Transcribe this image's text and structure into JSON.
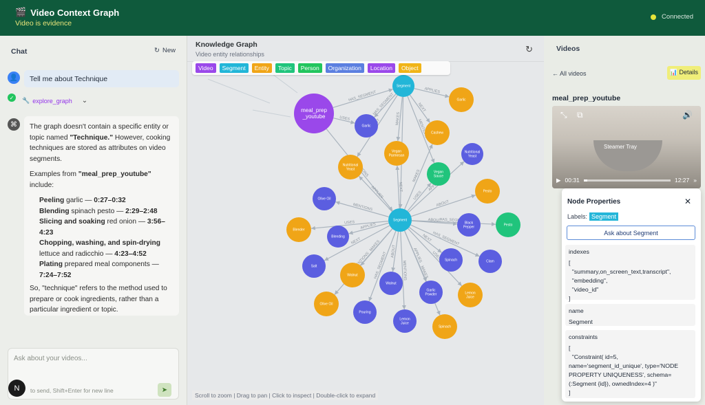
{
  "header": {
    "icon": "clapper-icon",
    "title": "Video Context Graph",
    "subtitle": "Video is evidence",
    "status": "Connected"
  },
  "chat": {
    "title": "Chat",
    "new_label": "New",
    "user_message": "Tell me about Technique",
    "tool_call": "explore_graph",
    "assistant": {
      "intro_1": "The graph doesn't contain a specific entity or topic named ",
      "intro_bold": "\"Technique.\"",
      "intro_2": " However, cooking techniques are stored as attributes on video segments.",
      "examples_1": "Examples from ",
      "examples_bold": "\"meal_prep_youtube\"",
      "examples_2": " include:",
      "items": [
        {
          "term": "Peeling",
          "rest": " garlic — ",
          "time": "0:27–0:32"
        },
        {
          "term": "Blending",
          "rest": " spinach pesto — ",
          "time": "2:29–2:48"
        },
        {
          "term": "Slicing and soaking",
          "rest": " red onion — ",
          "time": "3:56–4:23"
        },
        {
          "term": "Chopping, washing, and spin-drying",
          "rest": " lettuce and radicchio — ",
          "time": "4:23–4:52"
        },
        {
          "term": "Plating",
          "rest": " prepared meal components — ",
          "time": "7:24–7:52"
        }
      ],
      "conclusion": "So, \"technique\" refers to the method used to prepare or cook ingredients, rather than a particular ingredient or topic."
    },
    "input_placeholder": "Ask about your videos...",
    "input_hint": "to send, Shift+Enter for new line",
    "avatar_initial": "N"
  },
  "graph": {
    "title": "Knowledge Graph",
    "subtitle": "Video entity relationships",
    "legend": [
      {
        "label": "Video",
        "color": "#9a48ea"
      },
      {
        "label": "Segment",
        "color": "#22b6d8"
      },
      {
        "label": "Entity",
        "color": "#f0a517"
      },
      {
        "label": "Topic",
        "color": "#20c47c"
      },
      {
        "label": "Person",
        "color": "#22c55e"
      },
      {
        "label": "Organization",
        "color": "#5b7fe0"
      },
      {
        "label": "Location",
        "color": "#9a48ea"
      },
      {
        "label": "Object",
        "color": "#f0b417"
      }
    ],
    "help": "Scroll to zoom | Drag to pan | Click to inspect | Double-click to expand",
    "edge_labels": [
      "HAS_SEGMENT",
      "MENTIONS",
      "USES",
      "APPLIES",
      "NEXT",
      "MAKES",
      "ABOUT"
    ],
    "nodes": [
      {
        "id": "video",
        "label": "meal_prep\n_youtube",
        "color": "#9a48ea"
      },
      {
        "id": "seg1",
        "label": "Segment",
        "color": "#22b6d8"
      },
      {
        "id": "seg2",
        "label": "Segment",
        "color": "#22b6d8"
      },
      {
        "id": "garlic1",
        "label": "Garlic",
        "color": "#f0a517"
      },
      {
        "id": "garlic2",
        "label": "Garlic",
        "color": "#5b5ee0"
      },
      {
        "id": "cashew",
        "label": "Cashew",
        "color": "#f0a517"
      },
      {
        "id": "vegan_parm",
        "label": "Vegan\nParmesan",
        "color": "#f0a517"
      },
      {
        "id": "nutr1",
        "label": "Nutritional\nYeast",
        "color": "#f0a517"
      },
      {
        "id": "nutr2",
        "label": "Nutritional\nYeast",
        "color": "#5b5ee0"
      },
      {
        "id": "vegan_sauce",
        "label": "Vegan\nSauce",
        "color": "#20c47c"
      },
      {
        "id": "pesto1",
        "label": "Pesto",
        "color": "#f0a517"
      },
      {
        "id": "pesto2",
        "label": "Pesto",
        "color": "#20c47c"
      },
      {
        "id": "olive1",
        "label": "Olive Oil",
        "color": "#5b5ee0"
      },
      {
        "id": "olive2",
        "label": "Olive Oil",
        "color": "#f0a517"
      },
      {
        "id": "blender",
        "label": "Blender",
        "color": "#f0a517"
      },
      {
        "id": "blending",
        "label": "Blending",
        "color": "#5b5ee0"
      },
      {
        "id": "salt",
        "label": "Salt",
        "color": "#5b5ee0"
      },
      {
        "id": "walnut1",
        "label": "Walnut",
        "color": "#f0a517"
      },
      {
        "id": "walnut2",
        "label": "Walnut",
        "color": "#5b5ee0"
      },
      {
        "id": "pouring",
        "label": "Pouring",
        "color": "#5b5ee0"
      },
      {
        "id": "lemon1",
        "label": "Lemon\nJuice",
        "color": "#5b5ee0"
      },
      {
        "id": "lemon2",
        "label": "Lemon\nJuice",
        "color": "#f0a517"
      },
      {
        "id": "garlic_pw",
        "label": "Garlic\nPowder",
        "color": "#5b5ee0"
      },
      {
        "id": "spinach1",
        "label": "Spinach",
        "color": "#5b5ee0"
      },
      {
        "id": "spinach2",
        "label": "Spinach",
        "color": "#f0a517"
      },
      {
        "id": "blackpep",
        "label": "Black\nPepper",
        "color": "#5b5ee0"
      },
      {
        "id": "clam",
        "label": "Clam",
        "color": "#5b5ee0"
      }
    ]
  },
  "videos": {
    "title": "Videos",
    "back_label": "← All videos",
    "details_label": "Details",
    "video_name": "meal_prep_youtube",
    "player": {
      "current": "00:31",
      "duration": "12:27",
      "progress": 0.04,
      "caption": "Steamer Tray"
    }
  },
  "node_properties": {
    "title": "Node Properties",
    "labels_prefix": "Labels:",
    "label": "Segment",
    "ask_label": "Ask about Segment",
    "props": [
      {
        "key": "indexes",
        "value": "[\n  \"summary,on_screen_text,transcript\",\n  \"embedding\",\n  \"video_id\"\n]"
      },
      {
        "key": "name",
        "value": "Segment"
      },
      {
        "key": "constraints",
        "value": "[\n  \"Constraint( id=5, name='segment_id_unique', type='NODE PROPERTY UNIQUENESS', schema=(:Segment {id}), ownedIndex=4 )\"\n]"
      }
    ]
  }
}
